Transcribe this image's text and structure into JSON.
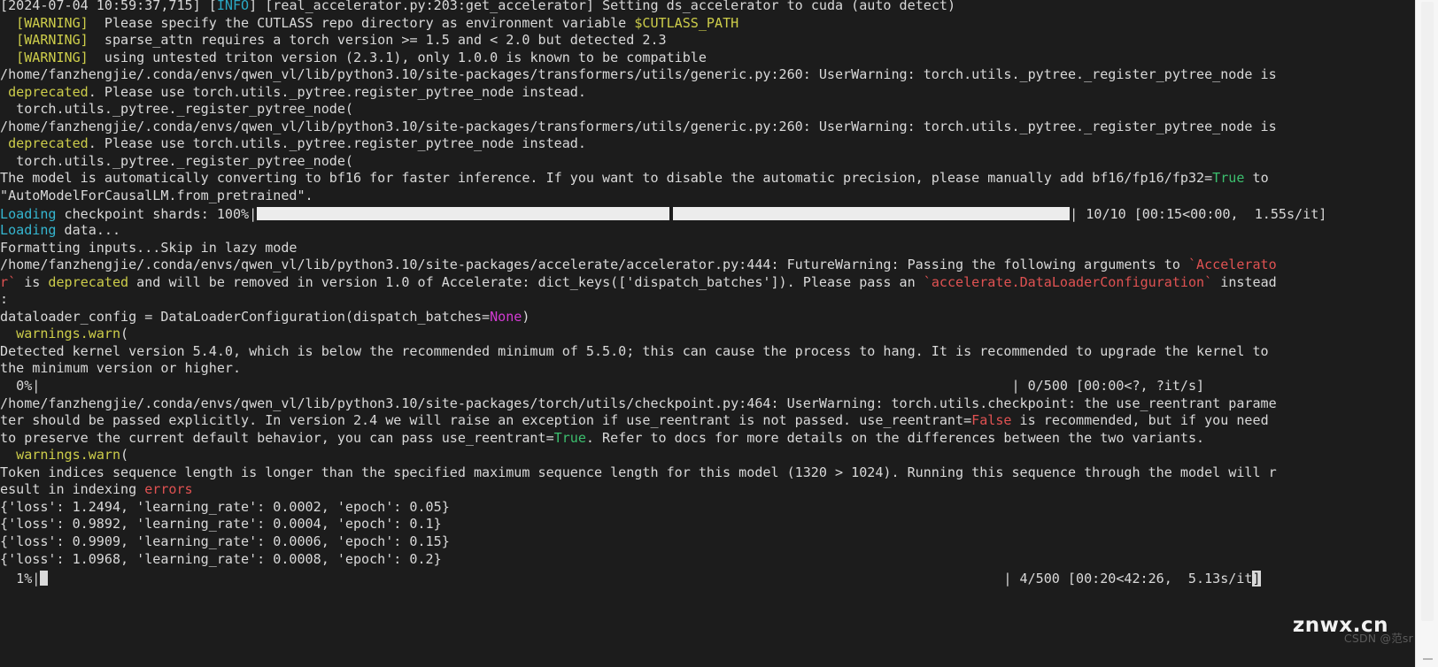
{
  "terminal": {
    "background_color": "#1c1c1c",
    "foreground_color": "#d9d9d9",
    "colors": {
      "info_cyan": "#2aa8c4",
      "warning_yellow": "#cdcd4a",
      "error_red": "#e05252",
      "true_green": "#3cbf6e",
      "none_magenta": "#d33bd3",
      "progress_bar_fill": "#ececec"
    },
    "lines": [
      {
        "id": "log-init-accelerator",
        "parts": [
          {
            "text": "[2024-07-04 10:59:37,715] [",
            "color": "plain"
          },
          {
            "text": "INFO",
            "color": "info"
          },
          {
            "text": "] [real_accelerator.py:203:get_accelerator] Setting ds_accelerator to cuda (auto detect)",
            "color": "plain"
          }
        ]
      },
      {
        "id": "warn-cutlass-path",
        "parts": [
          {
            "text": "  ",
            "color": "plain"
          },
          {
            "text": "[WARNING]",
            "color": "warn"
          },
          {
            "text": "  Please specify the CUTLASS repo directory as environment variable ",
            "color": "plain"
          },
          {
            "text": "$CUTLASS_PATH",
            "color": "warn"
          }
        ]
      },
      {
        "id": "warn-sparse-attn-torch",
        "parts": [
          {
            "text": "  ",
            "color": "plain"
          },
          {
            "text": "[WARNING]",
            "color": "warn"
          },
          {
            "text": "  sparse_attn requires a torch version >= 1.5 and < 2.0 but detected 2.3",
            "color": "plain"
          }
        ]
      },
      {
        "id": "warn-untested-triton",
        "parts": [
          {
            "text": "  ",
            "color": "plain"
          },
          {
            "text": "[WARNING]",
            "color": "warn"
          },
          {
            "text": "  using untested triton version (2.3.1), only 1.0.0 is known to be compatible",
            "color": "plain"
          }
        ]
      },
      {
        "id": "userwarning-pytree-path-1",
        "parts": [
          {
            "text": "/home/fanzhengjie/.conda/envs/qwen_vl/lib/python3.10/site-packages/transformers/utils/generic.py:260: UserWarning: torch.utils._pytree._register_pytree_node is",
            "color": "plain"
          }
        ]
      },
      {
        "id": "userwarning-pytree-deprecated-1",
        "parts": [
          {
            "text": " ",
            "color": "plain"
          },
          {
            "text": "deprecated",
            "color": "warn"
          },
          {
            "text": ". Please use torch.utils._pytree.register_pytree_node instead.",
            "color": "plain"
          }
        ]
      },
      {
        "id": "userwarning-pytree-call-1",
        "parts": [
          {
            "text": "  torch.utils._pytree._register_pytree_node(",
            "color": "plain"
          }
        ]
      },
      {
        "id": "userwarning-pytree-path-2",
        "parts": [
          {
            "text": "/home/fanzhengjie/.conda/envs/qwen_vl/lib/python3.10/site-packages/transformers/utils/generic.py:260: UserWarning: torch.utils._pytree._register_pytree_node is",
            "color": "plain"
          }
        ]
      },
      {
        "id": "userwarning-pytree-deprecated-2",
        "parts": [
          {
            "text": " ",
            "color": "plain"
          },
          {
            "text": "deprecated",
            "color": "warn"
          },
          {
            "text": ". Please use torch.utils._pytree.register_pytree_node instead.",
            "color": "plain"
          }
        ]
      },
      {
        "id": "userwarning-pytree-call-2",
        "parts": [
          {
            "text": "  torch.utils._pytree._register_pytree_node(",
            "color": "plain"
          }
        ]
      },
      {
        "id": "bf16-autoconvert-notice",
        "parts": [
          {
            "text": "The model is automatically converting to bf16 for faster inference. If you want to disable the automatic precision, please manually add bf16/fp16/fp32=",
            "color": "plain"
          },
          {
            "text": "True",
            "color": "green"
          },
          {
            "text": " to",
            "color": "plain"
          }
        ]
      },
      {
        "id": "bf16-autoconvert-notice-cont",
        "parts": [
          {
            "text": "\"AutoModelForCausalLM.from_pretrained\".",
            "color": "plain"
          }
        ]
      },
      {
        "id": "progress-checkpoint-shards",
        "type": "progress",
        "label": "Loading",
        "label_color": "cyan",
        "text_before": " checkpoint shards: 100%|",
        "text_after": "| 10/10 [00:15<00:00,  1.55s/it]",
        "percent": 100,
        "current": "10",
        "total": "10",
        "elapsed": "00:15",
        "remaining": "00:00",
        "rate": "1.55s/it"
      },
      {
        "id": "loading-data",
        "parts": [
          {
            "text": "Loading",
            "color": "cyan"
          },
          {
            "text": " data...",
            "color": "plain"
          }
        ]
      },
      {
        "id": "formatting-inputs",
        "parts": [
          {
            "text": "Formatting inputs...Skip in lazy mode",
            "color": "plain"
          }
        ]
      },
      {
        "id": "futurewarning-accelerator-path",
        "parts": [
          {
            "text": "/home/fanzhengjie/.conda/envs/qwen_vl/lib/python3.10/site-packages/accelerate/accelerator.py:444: FutureWarning: Passing the following arguments to ",
            "color": "plain"
          },
          {
            "text": "`Accelerato",
            "color": "red"
          }
        ]
      },
      {
        "id": "futurewarning-accelerator-cont",
        "parts": [
          {
            "text": "r`",
            "color": "red"
          },
          {
            "text": " is ",
            "color": "plain"
          },
          {
            "text": "deprecated",
            "color": "warn"
          },
          {
            "text": " and will be removed in version 1.0 of Accelerate: dict_keys(['dispatch_batches']). Please pass an ",
            "color": "plain"
          },
          {
            "text": "`accelerate.DataLoaderConfiguration`",
            "color": "red"
          },
          {
            "text": " instead",
            "color": "plain"
          }
        ]
      },
      {
        "id": "futurewarning-accelerator-colon",
        "parts": [
          {
            "text": ":",
            "color": "plain"
          }
        ]
      },
      {
        "id": "dataloader-config-line",
        "parts": [
          {
            "text": "dataloader_config = DataLoaderConfiguration(dispatch_batches=",
            "color": "plain"
          },
          {
            "text": "None",
            "color": "magenta"
          },
          {
            "text": ")",
            "color": "plain"
          }
        ]
      },
      {
        "id": "warnings-warn-1",
        "parts": [
          {
            "text": "  ",
            "color": "plain"
          },
          {
            "text": "warnings.warn",
            "color": "warn"
          },
          {
            "text": "(",
            "color": "plain"
          }
        ]
      },
      {
        "id": "kernel-version-warning",
        "parts": [
          {
            "text": "Detected kernel version 5.4.0, which is below the recommended minimum of 5.5.0; this can cause the process to hang. It is recommended to upgrade the kernel to",
            "color": "plain"
          }
        ]
      },
      {
        "id": "kernel-version-warning-cont",
        "parts": [
          {
            "text": "the minimum version or higher.",
            "color": "plain"
          }
        ]
      },
      {
        "id": "progress-train-0",
        "type": "progress-empty",
        "text_before": "  0%|",
        "text_after": "| 0/500 [00:00<?, ?it/s]",
        "percent": 0,
        "current": "0",
        "total": "500",
        "elapsed": "00:00",
        "remaining": "?",
        "rate": "?it/s"
      },
      {
        "id": "userwarning-checkpoint-path",
        "parts": [
          {
            "text": "/home/fanzhengjie/.conda/envs/qwen_vl/lib/python3.10/site-packages/torch/utils/checkpoint.py:464: UserWarning: torch.utils.checkpoint: the use_reentrant parame",
            "color": "plain"
          }
        ]
      },
      {
        "id": "userwarning-checkpoint-cont-1",
        "parts": [
          {
            "text": "ter should be passed explicitly. In version 2.4 we will raise an exception if use_reentrant is not passed. use_reentrant=",
            "color": "plain"
          },
          {
            "text": "False",
            "color": "red"
          },
          {
            "text": " is recommended, but if you need",
            "color": "plain"
          }
        ]
      },
      {
        "id": "userwarning-checkpoint-cont-2",
        "parts": [
          {
            "text": "to preserve the current default behavior, you can pass use_reentrant=",
            "color": "plain"
          },
          {
            "text": "True",
            "color": "green"
          },
          {
            "text": ". Refer to docs for more details on the differences between the two variants.",
            "color": "plain"
          }
        ]
      },
      {
        "id": "warnings-warn-2",
        "parts": [
          {
            "text": "  ",
            "color": "plain"
          },
          {
            "text": "warnings.warn",
            "color": "warn"
          },
          {
            "text": "(",
            "color": "plain"
          }
        ]
      },
      {
        "id": "token-indices-warning",
        "parts": [
          {
            "text": "Token indices sequence length is longer than the specified maximum sequence length for this model (1320 > 1024). Running this sequence through the model will r",
            "color": "plain"
          }
        ]
      },
      {
        "id": "token-indices-warning-cont",
        "parts": [
          {
            "text": "esult in indexing ",
            "color": "plain"
          },
          {
            "text": "errors",
            "color": "red"
          }
        ]
      },
      {
        "id": "train-log-step-1",
        "parts": [
          {
            "text": "{'loss': 1.2494, 'learning_rate': 0.0002, 'epoch': 0.05}",
            "color": "plain"
          }
        ]
      },
      {
        "id": "train-log-step-2",
        "parts": [
          {
            "text": "{'loss': 0.9892, 'learning_rate': 0.0004, 'epoch': 0.1}",
            "color": "plain"
          }
        ]
      },
      {
        "id": "train-log-step-3",
        "parts": [
          {
            "text": "{'loss': 0.9909, 'learning_rate': 0.0006, 'epoch': 0.15}",
            "color": "plain"
          }
        ]
      },
      {
        "id": "train-log-step-4",
        "parts": [
          {
            "text": "{'loss': 1.0968, 'learning_rate': 0.0008, 'epoch': 0.2}",
            "color": "plain"
          }
        ]
      },
      {
        "id": "progress-train-1",
        "type": "progress-cursor",
        "text_before": "  1%|",
        "text_after": "| 4/500 [00:20<42:26,  5.13s/it",
        "cursor_char": "]",
        "percent": 1,
        "current": "4",
        "total": "500",
        "elapsed": "00:20",
        "remaining": "42:26",
        "rate": "5.13s/it"
      }
    ]
  },
  "watermark": {
    "primary": "znwx.cn",
    "secondary": "CSDN @范sr"
  },
  "scrollbar": {
    "name": "vertical-scrollbar"
  },
  "training_data": {
    "steps": [
      {
        "loss": 1.2494,
        "learning_rate": 0.0002,
        "epoch": 0.05
      },
      {
        "loss": 0.9892,
        "learning_rate": 0.0004,
        "epoch": 0.1
      },
      {
        "loss": 0.9909,
        "learning_rate": 0.0006,
        "epoch": 0.15
      },
      {
        "loss": 1.0968,
        "learning_rate": 0.0008,
        "epoch": 0.2
      }
    ]
  }
}
